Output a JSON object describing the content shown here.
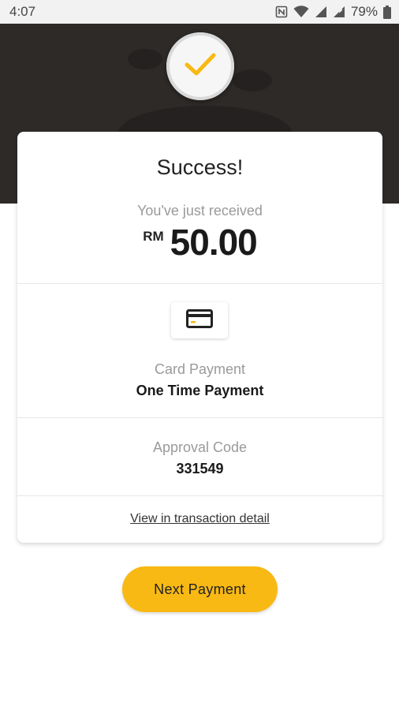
{
  "status_bar": {
    "time": "4:07",
    "battery": "79%",
    "icons": [
      "nfc-icon",
      "wifi-icon",
      "signal-icon",
      "signal-icon",
      "battery-icon"
    ]
  },
  "header": {
    "icon": "checkmark-icon"
  },
  "summary": {
    "title": "Success!",
    "received_label": "You've just received",
    "currency": "RM",
    "amount": "50.00"
  },
  "payment_method": {
    "icon": "credit-card-icon",
    "label": "Card Payment",
    "value": "One Time Payment"
  },
  "approval": {
    "label": "Approval Code",
    "value": "331549"
  },
  "link": {
    "label": "View in transaction detail"
  },
  "actions": {
    "next_label": "Next Payment"
  },
  "colors": {
    "accent": "#f8b914",
    "header_bg": "#2e2a28"
  }
}
